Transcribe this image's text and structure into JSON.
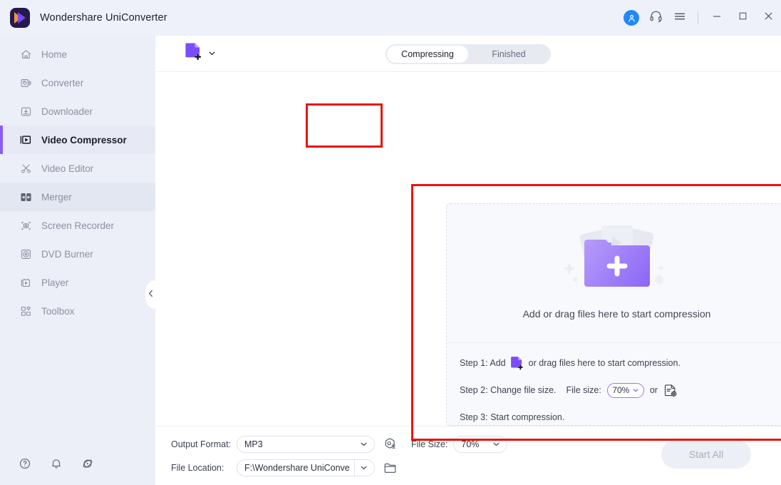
{
  "titlebar": {
    "app_title": "Wondershare UniConverter",
    "logo_icon": "wondershare-logo-icon",
    "account_icon": "user-avatar-icon",
    "support_icon": "headset-icon",
    "menu_icon": "hamburger-menu-icon",
    "minimize_icon": "minimize-icon",
    "maximize_icon": "maximize-icon",
    "close_icon": "close-icon",
    "accent_blue": "#2388f5"
  },
  "sidebar": {
    "bg": "#eceff8",
    "active_accent": "#8b5cf6",
    "items": [
      {
        "label": "Home",
        "icon": "home-icon",
        "state": "normal"
      },
      {
        "label": "Converter",
        "icon": "converter-icon",
        "state": "normal"
      },
      {
        "label": "Downloader",
        "icon": "downloader-icon",
        "state": "normal"
      },
      {
        "label": "Video Compressor",
        "icon": "video-compressor-icon",
        "state": "active"
      },
      {
        "label": "Video Editor",
        "icon": "scissors-icon",
        "state": "normal"
      },
      {
        "label": "Merger",
        "icon": "merger-icon",
        "state": "hover"
      },
      {
        "label": "Screen Recorder",
        "icon": "screen-recorder-icon",
        "state": "normal"
      },
      {
        "label": "DVD Burner",
        "icon": "dvd-burner-icon",
        "state": "normal"
      },
      {
        "label": "Player",
        "icon": "player-icon",
        "state": "normal"
      },
      {
        "label": "Toolbox",
        "icon": "toolbox-icon",
        "state": "normal"
      }
    ],
    "bottom_icons": [
      {
        "name": "help-icon"
      },
      {
        "name": "notification-bell-icon"
      },
      {
        "name": "update-icon"
      }
    ],
    "collapse_icon": "chevron-left-icon"
  },
  "toolbar": {
    "add_file_icon": "add-file-icon",
    "add_file_dropdown_icon": "chevron-down-icon",
    "tabs": [
      {
        "label": "Compressing",
        "selected": true
      },
      {
        "label": "Finished",
        "selected": false
      }
    ]
  },
  "dropzone": {
    "folder_icon": "folder-plus-icon",
    "prompt": "Add or drag files here to start compression",
    "steps": [
      {
        "prefix": "Step 1: Add",
        "suffix": "or drag files here to start compression.",
        "icon": "add-file-icon"
      },
      {
        "prefix": "Step 2: Change file size.",
        "file_size_label": "File size:",
        "file_size_value": "70%",
        "or_label": "or",
        "settings_icon": "file-settings-icon",
        "dropdown_icon": "chevron-down-icon"
      },
      {
        "prefix": "Step 3: Start compression."
      }
    ]
  },
  "bottombar": {
    "output_format_label": "Output Format:",
    "output_format_value": "MP3",
    "format_settings_icon": "format-settings-icon",
    "file_size_label": "File Size:",
    "file_size_value": "70%",
    "file_location_label": "File Location:",
    "file_location_value": "F:\\Wondershare UniConverter",
    "folder_icon": "open-folder-icon",
    "start_all_label": "Start All",
    "start_all_disabled": true,
    "dropdown_icon": "chevron-down-icon"
  },
  "annotations": {
    "color": "#e8150d",
    "regions": [
      {
        "name": "add-file-button-highlight"
      },
      {
        "name": "drop-area-highlight"
      }
    ]
  }
}
